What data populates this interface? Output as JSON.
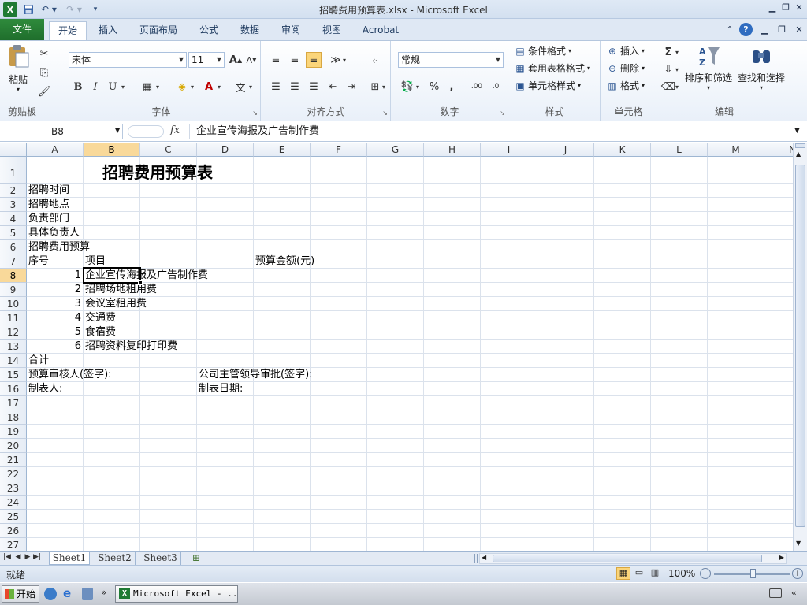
{
  "window": {
    "title": "招聘费用预算表.xlsx - Microsoft Excel"
  },
  "ribbon": {
    "tabs": [
      {
        "label": "文件"
      },
      {
        "label": "开始"
      },
      {
        "label": "插入"
      },
      {
        "label": "页面布局"
      },
      {
        "label": "公式"
      },
      {
        "label": "数据"
      },
      {
        "label": "审阅"
      },
      {
        "label": "视图"
      },
      {
        "label": "Acrobat"
      }
    ],
    "active_tab": "开始",
    "groups": {
      "clipboard": {
        "label": "剪贴板",
        "paste_label": "粘贴"
      },
      "font": {
        "label": "字体",
        "font_name": "宋体",
        "font_size": "11"
      },
      "alignment": {
        "label": "对齐方式"
      },
      "number": {
        "label": "数字",
        "format": "常规"
      },
      "styles": {
        "label": "样式",
        "conditional": "条件格式",
        "table_format": "套用表格格式",
        "cell_styles": "单元格样式"
      },
      "cells": {
        "label": "单元格",
        "insert": "插入",
        "delete": "删除",
        "format": "格式"
      },
      "editing": {
        "label": "编辑",
        "sort_filter": "排序和筛选",
        "find_select": "查找和选择"
      }
    }
  },
  "formula_bar": {
    "name_box": "B8",
    "fx": "fx",
    "content": "企业宣传海报及广告制作费"
  },
  "grid": {
    "columns": [
      "A",
      "B",
      "C",
      "D",
      "E",
      "F",
      "G",
      "H",
      "I",
      "J",
      "K",
      "L",
      "M",
      "N"
    ],
    "rows": [
      "1",
      "2",
      "3",
      "4",
      "5",
      "6",
      "7",
      "8",
      "9",
      "10",
      "11",
      "12",
      "13",
      "14",
      "15",
      "16",
      "17",
      "18",
      "19",
      "20",
      "21",
      "22",
      "23",
      "24",
      "25",
      "26",
      "27"
    ],
    "selected_cell": "B8",
    "cells": {
      "b1": "招聘费用预算表",
      "a2": "招聘时间",
      "a3": "招聘地点",
      "a4": "负责部门",
      "a5": "具体负责人",
      "a6": "招聘费用预算",
      "a7": "序号",
      "b7": "项目",
      "e7": "预算金额(元)",
      "a8": "1",
      "b8": "企业宣传海报及广告制作费",
      "a9": "2",
      "b9": "招聘场地租用费",
      "a10": "3",
      "b10": "会议室租用费",
      "a11": "4",
      "b11": "交通费",
      "a12": "5",
      "b12": "食宿费",
      "a13": "6",
      "b13": "招聘资料复印打印费",
      "a14": "合计",
      "a15": "预算审核人(签字):",
      "d15": "公司主管领导审批(签字):",
      "a16": "制表人:",
      "d16": "制表日期:"
    }
  },
  "sheets": [
    {
      "label": "Sheet1"
    },
    {
      "label": "Sheet2"
    },
    {
      "label": "Sheet3"
    }
  ],
  "status_bar": {
    "status": "就绪",
    "zoom": "100%"
  },
  "taskbar": {
    "start": "开始",
    "task": "Microsoft Excel - ..."
  }
}
